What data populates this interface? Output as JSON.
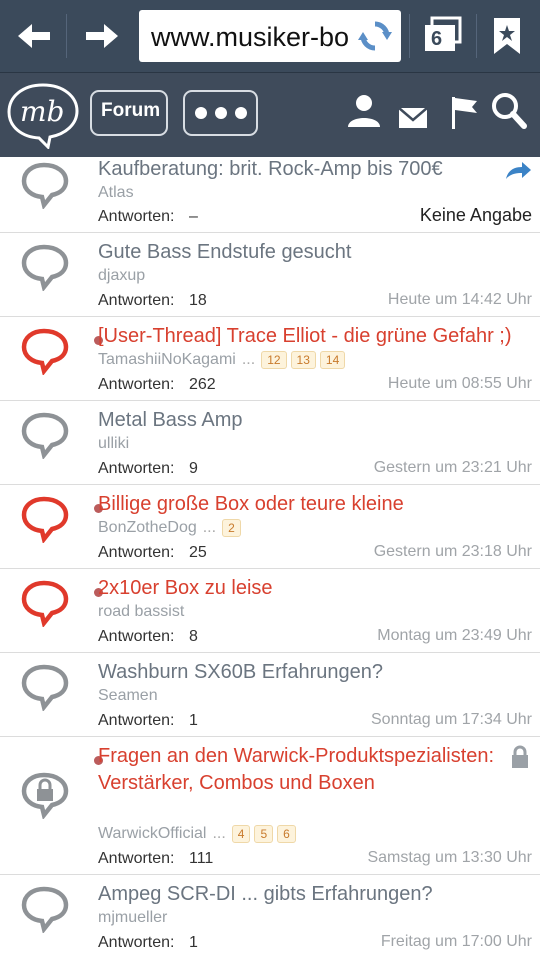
{
  "browser": {
    "url": "www.musiker-bo",
    "tab_count": "6"
  },
  "forum_bar": {
    "logo_text": "mb",
    "forum_label": "Forum"
  },
  "threads": [
    {
      "title": "Kaufberatung: brit. Rock-Amp bis 700€",
      "author": "Atlas",
      "replies_label": "Antworten:",
      "replies": "–",
      "date": "Keine Angabe",
      "hot": false,
      "pages": []
    },
    {
      "title": "Gute Bass Endstufe gesucht",
      "author": "djaxup",
      "replies_label": "Antworten:",
      "replies": "18",
      "date": "Heute um 14:42 Uhr",
      "hot": false,
      "pages": []
    },
    {
      "title": "[User-Thread] Trace Elliot - die grüne Gefahr ;)",
      "author": "TamashiiNoKagami",
      "replies_label": "Antworten:",
      "replies": "262",
      "date": "Heute um 08:55 Uhr",
      "hot": true,
      "pages": [
        "12",
        "13",
        "14"
      ]
    },
    {
      "title": "Metal Bass Amp",
      "author": "ulliki",
      "replies_label": "Antworten:",
      "replies": "9",
      "date": "Gestern um 23:21 Uhr",
      "hot": false,
      "pages": []
    },
    {
      "title": "Billige große Box oder teure kleine",
      "author": "BonZotheDog",
      "replies_label": "Antworten:",
      "replies": "25",
      "date": "Gestern um 23:18 Uhr",
      "hot": true,
      "pages": [
        "2"
      ]
    },
    {
      "title": "2x10er Box zu leise",
      "author": "road bassist",
      "replies_label": "Antworten:",
      "replies": "8",
      "date": "Montag um 23:49 Uhr",
      "hot": true,
      "pages": []
    },
    {
      "title": "Washburn SX60B Erfahrungen?",
      "author": "Seamen",
      "replies_label": "Antworten:",
      "replies": "1",
      "date": "Sonntag um 17:34 Uhr",
      "hot": false,
      "pages": []
    },
    {
      "title": "Fragen an den Warwick-Produktspezialisten: Verstärker, Combos und Boxen",
      "author": "WarwickOfficial",
      "replies_label": "Antworten:",
      "replies": "111",
      "date": "Samstag um 13:30 Uhr",
      "hot": true,
      "pages": [
        "4",
        "5",
        "6"
      ]
    },
    {
      "title": "Ampeg SCR-DI ... gibts Erfahrungen?",
      "author": "mjmueller",
      "replies_label": "Antworten:",
      "replies": "1",
      "date": "Freitag um 17:00 Uhr",
      "hot": false,
      "pages": []
    }
  ],
  "colors": {
    "toolbar": "#3b4a5b",
    "hot_title": "#d8402f",
    "normal_title": "#6b7580",
    "bubble_hot": "#e0392b",
    "bubble_normal": "#8e9296"
  }
}
